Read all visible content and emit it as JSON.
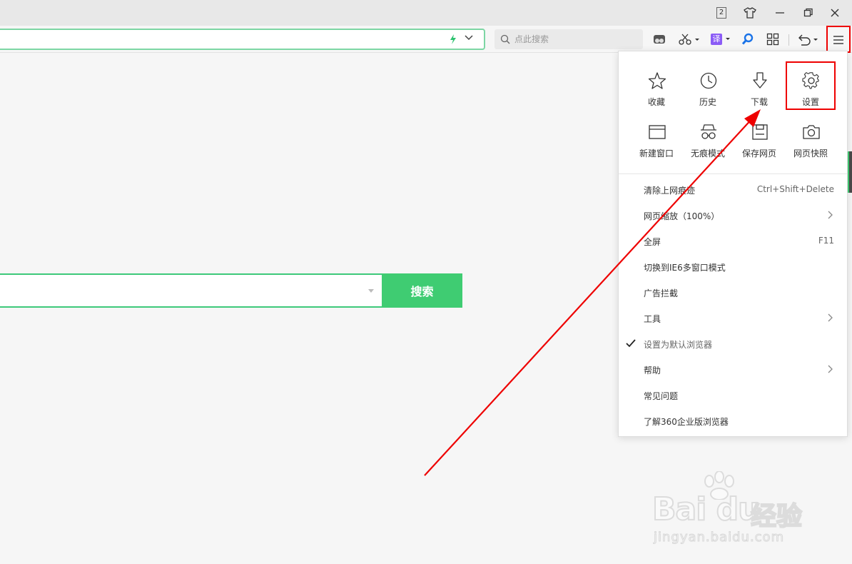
{
  "titlebar": {
    "tab_count": "2",
    "icons": [
      "tab-count-icon",
      "skin-shirt-icon",
      "minimize-icon",
      "restore-icon",
      "close-icon"
    ]
  },
  "toolbar": {
    "search_placeholder": "点此搜索",
    "icons": [
      "extension-icon",
      "scissors-icon",
      "translate-icon",
      "magnifier-icon",
      "apps-grid-icon",
      "undo-icon",
      "menu-icon"
    ],
    "translate_label": "译"
  },
  "page": {
    "search_button": "搜索"
  },
  "menu": {
    "grid": [
      {
        "label": "收藏",
        "icon": "star-icon"
      },
      {
        "label": "历史",
        "icon": "clock-icon"
      },
      {
        "label": "下载",
        "icon": "download-icon"
      },
      {
        "label": "设置",
        "icon": "gear-icon"
      },
      {
        "label": "新建窗口",
        "icon": "window-icon"
      },
      {
        "label": "无痕模式",
        "icon": "incognito-icon"
      },
      {
        "label": "保存网页",
        "icon": "save-icon"
      },
      {
        "label": "网页快照",
        "icon": "camera-icon"
      }
    ],
    "items": [
      {
        "label": "清除上网痕迹",
        "shortcut": "Ctrl+Shift+Delete"
      },
      {
        "label": "网页缩放（100%）",
        "submenu": true
      },
      {
        "label": "全屏",
        "shortcut": "F11"
      },
      {
        "label": "切换到IE6多窗口模式"
      },
      {
        "label": "广告拦截"
      },
      {
        "label": "工具",
        "submenu": true
      },
      {
        "label": "设置为默认浏览器",
        "checked": true
      },
      {
        "label": "帮助",
        "submenu": true
      },
      {
        "label": "常见问题"
      },
      {
        "label": "了解360企业版浏览器"
      }
    ]
  },
  "watermark": {
    "logo": "Bai du",
    "brand_cn": "经验",
    "url": "jingyan.baidu.com"
  },
  "colors": {
    "accent_green": "#3fcc72",
    "highlight_red": "#e00000",
    "translate_purple": "#8b5cf6"
  }
}
